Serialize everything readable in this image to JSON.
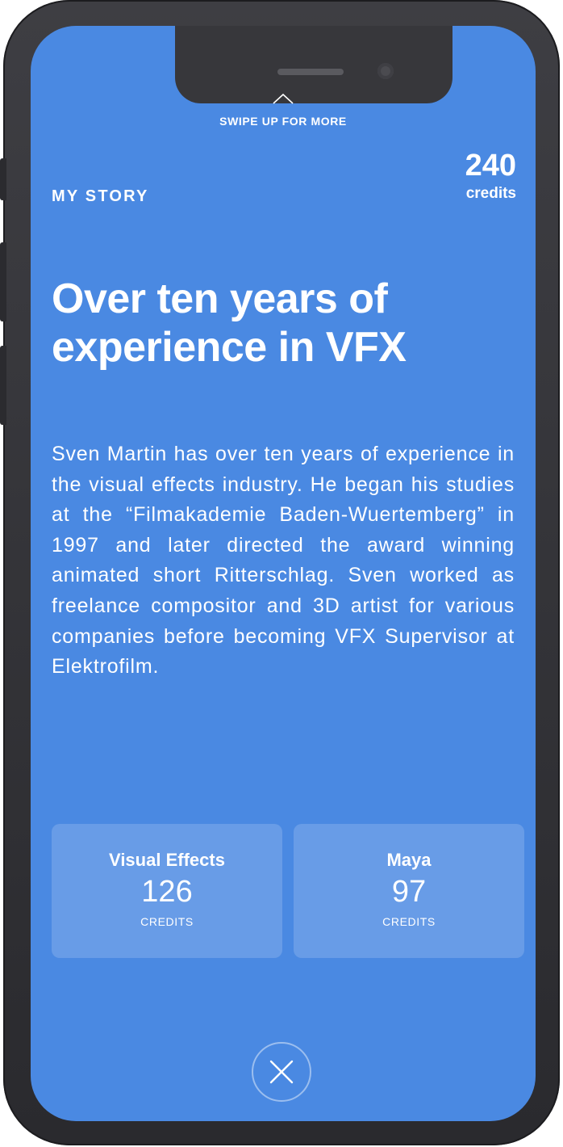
{
  "header": {
    "swipe_hint": "SWIPE UP FOR MORE",
    "section_label": "MY STORY",
    "credits_total": "240",
    "credits_label": "credits"
  },
  "story": {
    "headline": "Over ten years of experience in VFX",
    "bio": "Sven Martin has over ten years of experience in the visual effects industry. He began his studies at the “Filmakademie Baden-Wuertemberg” in 1997 and later directed the award winning animated short Ritterschlag. Sven worked as freelance compositor and 3D artist for various companies before becoming VFX Supervisor at Elektrofilm."
  },
  "skills": [
    {
      "name": "Visual Effects",
      "value": "126",
      "unit": "CREDITS"
    },
    {
      "name": "Maya",
      "value": "97",
      "unit": "CREDITS"
    }
  ],
  "icons": {
    "swipe": "chevron-up-icon",
    "close": "close-icon"
  },
  "colors": {
    "screen_background": "#4a89e2",
    "frame": "#333337",
    "text": "#ffffff"
  }
}
